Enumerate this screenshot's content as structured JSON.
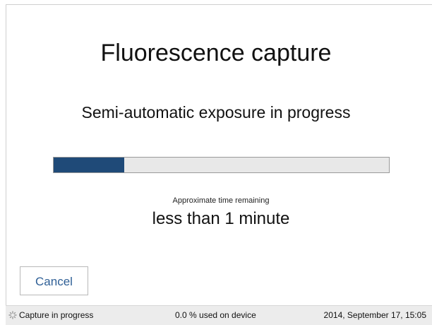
{
  "dialog": {
    "title": "Fluorescence capture",
    "subtitle": "Semi-automatic exposure in progress"
  },
  "progress": {
    "fraction": 0.21,
    "fill_color": "#1f4a78",
    "track_color": "#e8e8e8",
    "caption": "Approximate time remaining",
    "time_remaining": "less than 1 minute"
  },
  "buttons": {
    "cancel_label": "Cancel"
  },
  "statusbar": {
    "icon": "spinner-icon",
    "status_text": "Capture in progress",
    "storage_text": "0.0 % used on device",
    "datetime": "2014, September 17, 15:05"
  }
}
